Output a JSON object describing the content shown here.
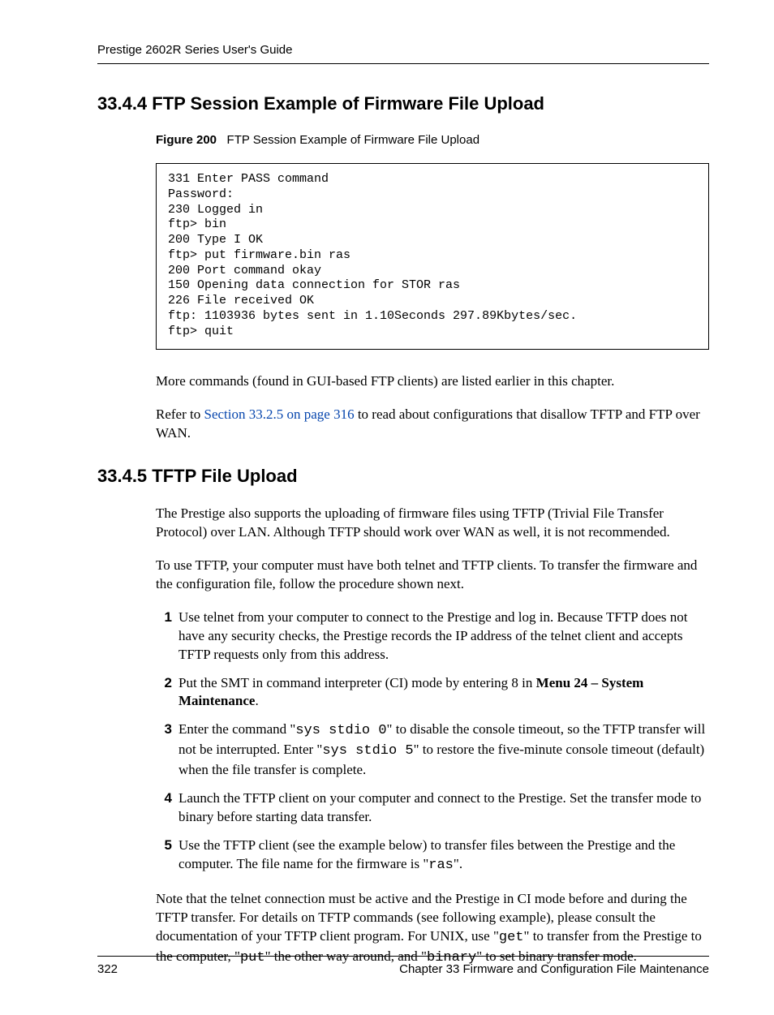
{
  "header": {
    "running_head": "Prestige 2602R Series User's Guide"
  },
  "section_3444": {
    "heading": "33.4.4  FTP Session Example of Firmware File Upload",
    "figure_label": "Figure 200",
    "figure_caption": "FTP Session Example of Firmware File Upload",
    "code": "331 Enter PASS command\nPassword:\n230 Logged in\nftp> bin\n200 Type I OK\nftp> put firmware.bin ras\n200 Port command okay\n150 Opening data connection for STOR ras\n226 File received OK\nftp: 1103936 bytes sent in 1.10Seconds 297.89Kbytes/sec.\nftp> quit",
    "para1": "More commands (found in GUI-based FTP clients) are listed earlier in this chapter.",
    "para2_pre": "Refer to ",
    "para2_xref": "Section 33.2.5 on page 316",
    "para2_post": " to read about configurations that disallow TFTP and FTP over WAN."
  },
  "section_3445": {
    "heading": "33.4.5  TFTP File Upload",
    "para1": "The Prestige also supports the uploading of firmware files using TFTP (Trivial File Transfer Protocol) over LAN. Although TFTP should work over WAN as well, it is not recommended.",
    "para2": "To use TFTP, your computer must have both telnet and TFTP clients. To transfer the firmware and the configuration file, follow the procedure shown next.",
    "steps": {
      "s1_num": "1",
      "s1": "Use telnet from your computer to connect to the Prestige and log in. Because TFTP does not have any security checks, the Prestige records the IP address of the telnet client and accepts TFTP requests only from this address.",
      "s2_num": "2",
      "s2_pre": "Put the SMT in command interpreter (CI) mode by entering 8 in ",
      "s2_bold": "Menu 24 – System Maintenance",
      "s2_post": ".",
      "s3_num": "3",
      "s3_a": "Enter the command \"",
      "s3_code1": "sys stdio 0",
      "s3_b": "\" to disable the console timeout, so the TFTP transfer will not be interrupted. Enter \"",
      "s3_code2": "sys stdio 5",
      "s3_c": "\" to restore the five-minute console timeout (default) when the file transfer is complete.",
      "s4_num": "4",
      "s4": "Launch the TFTP client on your computer and connect to the Prestige. Set the transfer mode to binary before starting data transfer.",
      "s5_num": "5",
      "s5_a": "Use the TFTP client (see the example below) to transfer files between the Prestige and the computer. The file name for the firmware is \"",
      "s5_code": "ras",
      "s5_b": "\"."
    },
    "note_a": "Note that the telnet connection must be active and the Prestige in CI mode before and during the TFTP transfer. For details on TFTP commands (see following example), please consult the documentation of your TFTP client program. For UNIX, use \"",
    "note_code1": "get",
    "note_b": "\" to transfer from the Prestige to the computer, \"",
    "note_code2": "put",
    "note_c": "\" the other way around, and \"",
    "note_code3": "binary",
    "note_d": "\" to set binary transfer mode."
  },
  "footer": {
    "page_number": "322",
    "chapter": "Chapter 33 Firmware and Configuration File Maintenance"
  }
}
